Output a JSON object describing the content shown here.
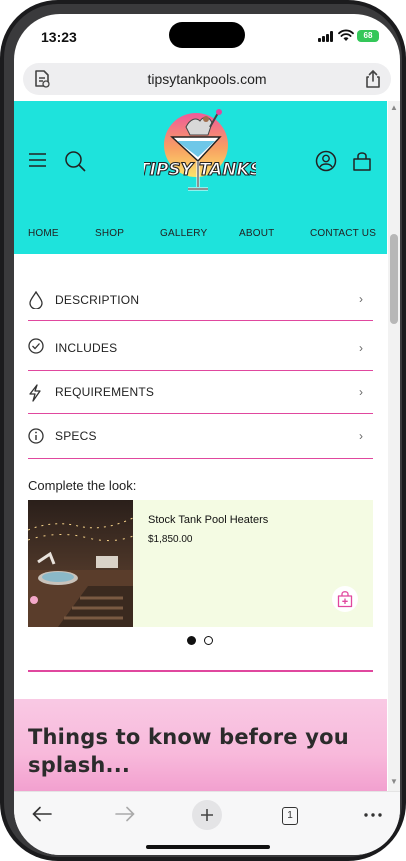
{
  "status_bar": {
    "time": "13:23",
    "battery": "68",
    "icons": [
      "signal-icon",
      "wifi-icon",
      "battery-icon"
    ]
  },
  "browser": {
    "url": "tipsytankpools.com",
    "icons": [
      "reader-icon",
      "share-icon"
    ]
  },
  "site": {
    "logo_text": "TIPSY TANKS",
    "brand_color": "#1ee3dc",
    "accent_color": "#e0479e",
    "nav": [
      "HOME",
      "SHOP",
      "GALLERY",
      "ABOUT",
      "CONTACT US"
    ],
    "header_icons": [
      "menu-icon",
      "search-icon",
      "account-icon",
      "cart-icon"
    ]
  },
  "accordion": [
    {
      "label": "DESCRIPTION",
      "icon": "droplet-icon"
    },
    {
      "label": "INCLUDES",
      "icon": "check-circle-icon"
    },
    {
      "label": "REQUIREMENTS",
      "icon": "bolt-icon"
    },
    {
      "label": "SPECS",
      "icon": "info-icon"
    }
  ],
  "complete_the_look": {
    "title": "Complete the look:",
    "product": {
      "name": "Stock Tank Pool Heaters",
      "price": "$1,850.00"
    },
    "carousel": {
      "current": 1,
      "total": 2
    }
  },
  "banner": {
    "text": "Things to know before you splash..."
  },
  "toolbar": {
    "tab_count": "1",
    "icons": [
      "back-icon",
      "forward-icon",
      "new-tab-icon",
      "tabs-icon",
      "more-icon"
    ]
  }
}
